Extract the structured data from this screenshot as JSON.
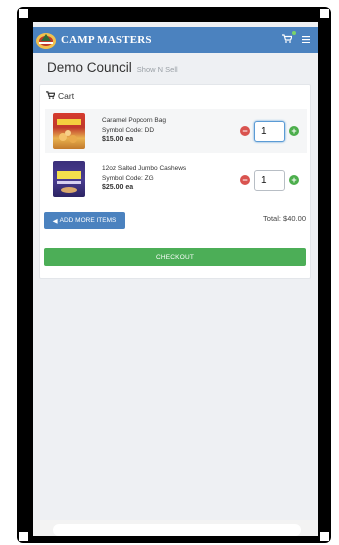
{
  "app": {
    "brand": "CAMP MASTERS"
  },
  "header": {
    "council": "Demo Council",
    "subtitle": "Show N Sell"
  },
  "cart": {
    "title": "Cart",
    "items": [
      {
        "name": "Caramel Popcorn Bag",
        "symbol": "Symbol Code: DD",
        "price": "$15.00 ea",
        "qty": "1"
      },
      {
        "name": "12oz Salted Jumbo Cashews",
        "symbol": "Symbol Code: ZG",
        "price": "$25.00 ea",
        "qty": "1"
      }
    ],
    "add_more_label": "ADD MORE ITEMS",
    "total": "Total: $40.00",
    "checkout_label": "CHECKOUT"
  },
  "colors": {
    "brand_blue": "#4b82bf",
    "checkout_green": "#4cae57",
    "minus_red": "#d9534f",
    "plus_green": "#4cae4c"
  },
  "icons": [
    "logo-icon",
    "cart-icon",
    "menu-icon",
    "minus-icon",
    "plus-icon",
    "arrow-left-icon"
  ]
}
